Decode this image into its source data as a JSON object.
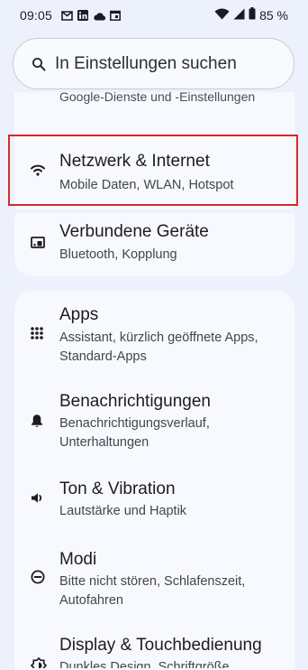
{
  "status": {
    "time": "09:05",
    "battery": "85 %",
    "left_icons": [
      "gmail-icon",
      "linkedin-icon",
      "cloud-icon",
      "calendar-icon"
    ],
    "right_icons": [
      "wifi-icon",
      "cellular-signal-icon",
      "battery-icon"
    ]
  },
  "search": {
    "placeholder": "In Einstellungen suchen"
  },
  "truncated_item": {
    "subtitle": "Google-Dienste und -Einstellungen"
  },
  "items": [
    {
      "title": "Netzwerk & Internet",
      "subtitle": "Mobile Daten, WLAN, Hotspot",
      "icon": "wifi-icon"
    },
    {
      "title": "Verbundene Geräte",
      "subtitle": "Bluetooth, Kopplung",
      "icon": "devices-icon"
    },
    {
      "title": "Apps",
      "subtitle": "Assistant, kürzlich geöffnete Apps, Standard-Apps",
      "icon": "apps-grid-icon"
    },
    {
      "title": "Benachrichtigungen",
      "subtitle": "Benachrichtigungsverlauf, Unterhaltungen",
      "icon": "bell-icon"
    },
    {
      "title": "Ton & Vibration",
      "subtitle": "Lautstärke und Haptik",
      "icon": "volume-icon"
    },
    {
      "title": "Modi",
      "subtitle": "Bitte nicht stören, Schlafenszeit, Autofahren",
      "icon": "modes-icon"
    },
    {
      "title": "Display & Touchbedienung",
      "subtitle": "Dunkles Design, Schriftgröße",
      "icon": "display-icon"
    }
  ],
  "colors": {
    "highlight": "#d52a2a",
    "background": "#edf1fb",
    "card": "#f8f9fe"
  }
}
